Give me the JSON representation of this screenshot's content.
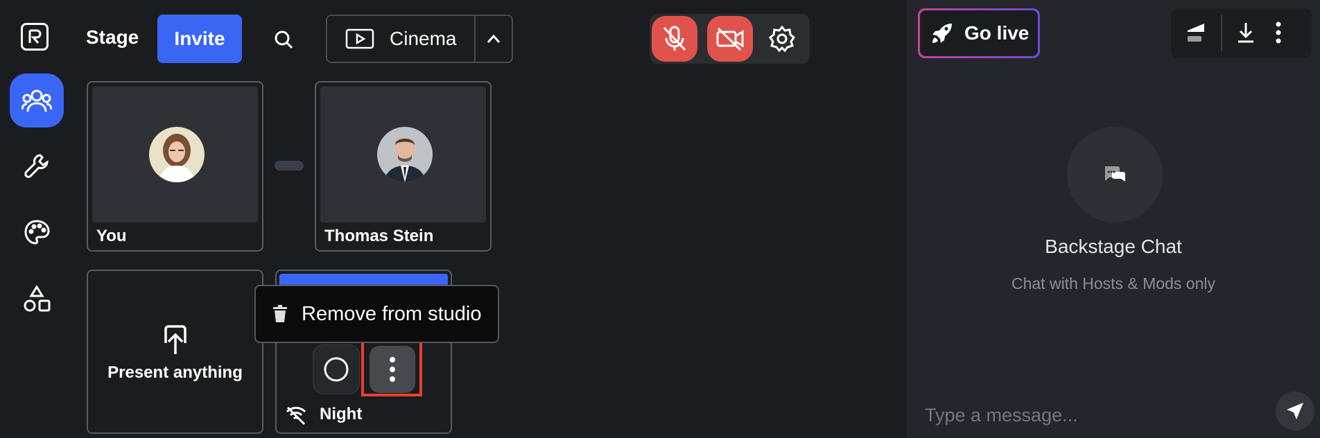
{
  "header": {
    "title": "Stage",
    "invite_label": "Invite",
    "layout_label": "Cinema"
  },
  "sidebar": {
    "items": [
      {
        "icon": "people-icon",
        "active": true
      },
      {
        "icon": "wrench-icon",
        "active": false
      },
      {
        "icon": "palette-icon",
        "active": false
      },
      {
        "icon": "shapes-icon",
        "active": false
      }
    ]
  },
  "controls": {
    "mic": "mic-off-icon",
    "camera": "camera-off-icon",
    "settings": "gear-icon",
    "danger_color": "#e0534c"
  },
  "participants": [
    {
      "name": "You"
    },
    {
      "name": "Thomas Stein"
    }
  ],
  "present": {
    "label": "Present anything"
  },
  "guest": {
    "name": "Night"
  },
  "popup": {
    "label": "Remove from studio"
  },
  "right_panel": {
    "go_live_label": "Go live",
    "chat_title": "Backstage Chat",
    "chat_subtitle": "Chat with Hosts & Mods only",
    "message_placeholder": "Type a message..."
  },
  "colors": {
    "accent": "#3a66f5",
    "highlight": "#e8402f",
    "background": "#1b1c1f",
    "panel": "#25262b"
  }
}
